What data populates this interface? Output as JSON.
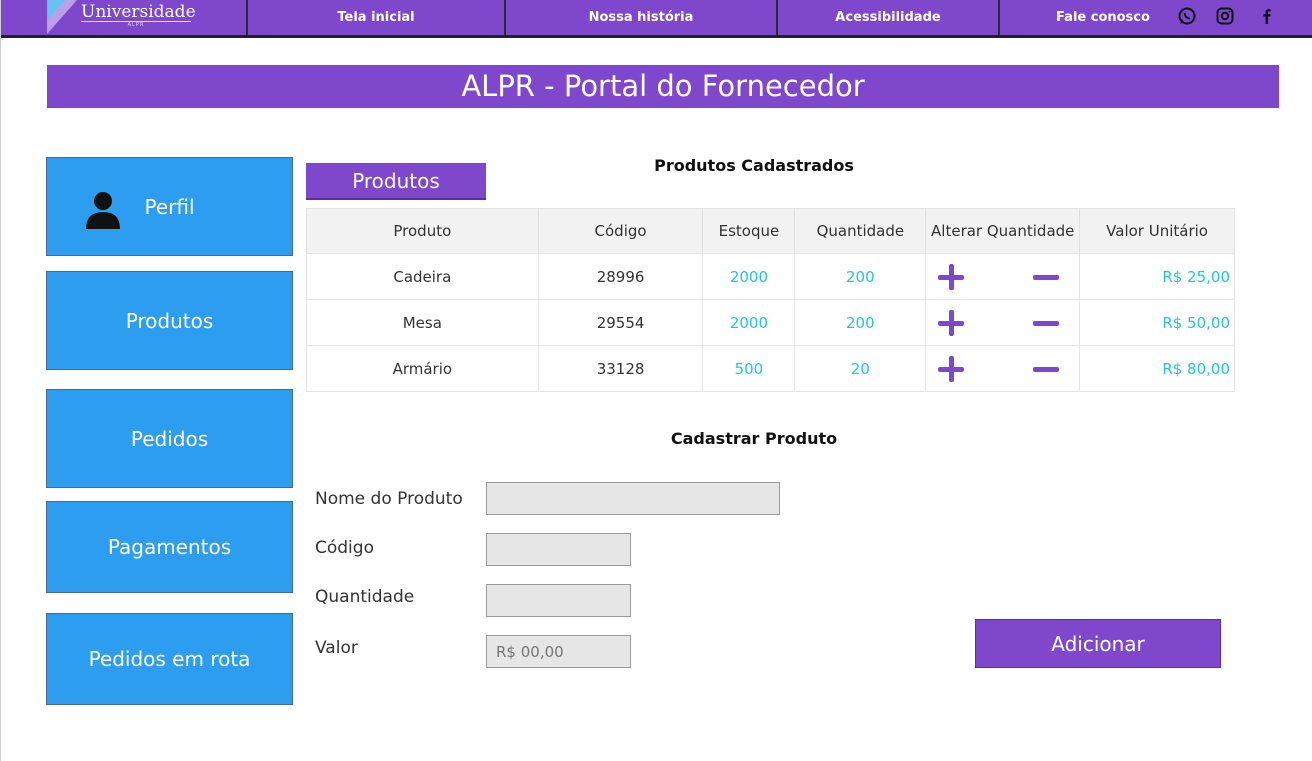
{
  "nav": {
    "logo_text": "Universidade",
    "logo_sub": "ALPR",
    "items": [
      "Tela inicial",
      "Nossa história",
      "Acessibilidade",
      "Fale conosco"
    ],
    "social_icons": [
      "whatsapp-icon",
      "instagram-icon",
      "facebook-icon"
    ]
  },
  "banner": {
    "title": "ALPR - Portal do Fornecedor"
  },
  "sidebar": {
    "items": [
      {
        "label": "Perfil",
        "icon": "user-icon"
      },
      {
        "label": "Produtos"
      },
      {
        "label": "Pedidos"
      },
      {
        "label": "Pagamentos"
      },
      {
        "label": "Pedidos em rota"
      }
    ]
  },
  "products": {
    "tab_label": "Produtos",
    "table_title": "Produtos Cadastrados",
    "columns": [
      "Produto",
      "Código",
      "Estoque",
      "Quantidade",
      "Alterar Quantidade",
      "Valor Unitário"
    ],
    "rows": [
      {
        "produto": "Cadeira",
        "codigo": "28996",
        "estoque": "2000",
        "quantidade": "200",
        "valor": "R$ 25,00"
      },
      {
        "produto": "Mesa",
        "codigo": "29554",
        "estoque": "2000",
        "quantidade": "200",
        "valor": "R$ 50,00"
      },
      {
        "produto": "Armário",
        "codigo": "33128",
        "estoque": "500",
        "quantidade": "20",
        "valor": "R$ 80,00"
      }
    ]
  },
  "form": {
    "title": "Cadastrar Produto",
    "nome_label": "Nome do Produto",
    "codigo_label": "Código",
    "quantidade_label": "Quantidade",
    "valor_label": "Valor",
    "valor_placeholder": "R$ 00,00",
    "submit_label": "Adicionar"
  },
  "colors": {
    "purple": "#7e47cc",
    "blue": "#2d9df0",
    "teal": "#25c4d2"
  }
}
